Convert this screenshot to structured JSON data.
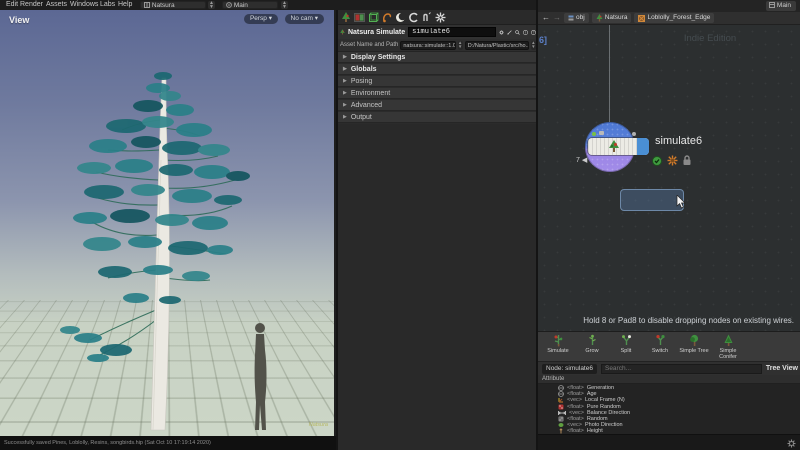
{
  "theme": {
    "accent_blue": "#4a8fd4",
    "selection_blue": "#4d78d4",
    "node_purple": "#9b85e6",
    "foliage_teal": "#2a7f88",
    "canvas_gray": "#2c2f30",
    "watermark_gray": "#454c50"
  },
  "menu": {
    "items": [
      "Edit",
      "Render",
      "Assets",
      "Windows",
      "Labs",
      "Help"
    ],
    "desktop_combo": "Natsura",
    "layout_combo": "Main"
  },
  "viewport": {
    "label": "View",
    "persp_badge": "Persp",
    "cam_badge": "No cam",
    "watermark": "Natsura",
    "status_text": "Successfully saved Pines, Loblolly, Resins, songbirds.hip (Sat Oct 10 17:19:14 2020)"
  },
  "params": {
    "toolbar_icons": [
      "tree-icon",
      "image-icon",
      "wire-cube-icon",
      "hook-icon",
      "moon-icon",
      "recook-icon",
      "notes-icon",
      "burst-icon"
    ],
    "panel_title": "Natsura Simulate",
    "node_name_value": "simulate6",
    "header_icons": [
      "gear-icon",
      "slider-icon",
      "magnifier-icon",
      "info-icon",
      "help-icon"
    ],
    "asset_label": "Asset Name and Path",
    "asset_name_value": "natsura::simulate::1.0",
    "asset_path_value": "D:/Natura/Plastic/src/ho...",
    "sections": [
      "Display Settings",
      "Globals",
      "Posing",
      "Environment",
      "Advanced",
      "Output"
    ]
  },
  "network": {
    "pane_tab": "Main",
    "breadcrumb": [
      "obj",
      "Natsura",
      "Loblolly_Forest_Edge"
    ],
    "clipped_badge": "6]",
    "watermark": "Indie Edition",
    "node": {
      "label": "simulate6",
      "input_badge": "7 ◀"
    },
    "hint": "Hold 8 or Pad8 to disable dropping nodes on existing wires."
  },
  "shelf": {
    "tools": [
      {
        "label": "Simulate"
      },
      {
        "label": "Grow"
      },
      {
        "label": "Split"
      },
      {
        "label": "Switch"
      },
      {
        "label": "Simple Tree"
      },
      {
        "label": "Simple Conifer"
      }
    ]
  },
  "network_footer": {
    "node_chip": "Node: simulate6",
    "search_placeholder": "Search...",
    "tree_view_label": "Tree View",
    "attr_header": "Attribute",
    "attributes": [
      {
        "type": "<float>",
        "name": "Generation",
        "icon": "globe-icon"
      },
      {
        "type": "<float>",
        "name": "Age",
        "icon": "globe-icon"
      },
      {
        "type": "<vec>",
        "name": "Local Frame (N)",
        "icon": "axes-icon"
      },
      {
        "type": "<float>",
        "name": "Pure Random",
        "icon": "red-dice-icon"
      },
      {
        "type": "<vec>",
        "name": "Balance Direction",
        "icon": "balance-icon"
      },
      {
        "type": "<float>",
        "name": "Random",
        "icon": "gray-dice-icon"
      },
      {
        "type": "<vec>",
        "name": "Photo Direction",
        "icon": "leaf-icon"
      },
      {
        "type": "<float>",
        "name": "Height",
        "icon": "height-icon"
      }
    ]
  }
}
